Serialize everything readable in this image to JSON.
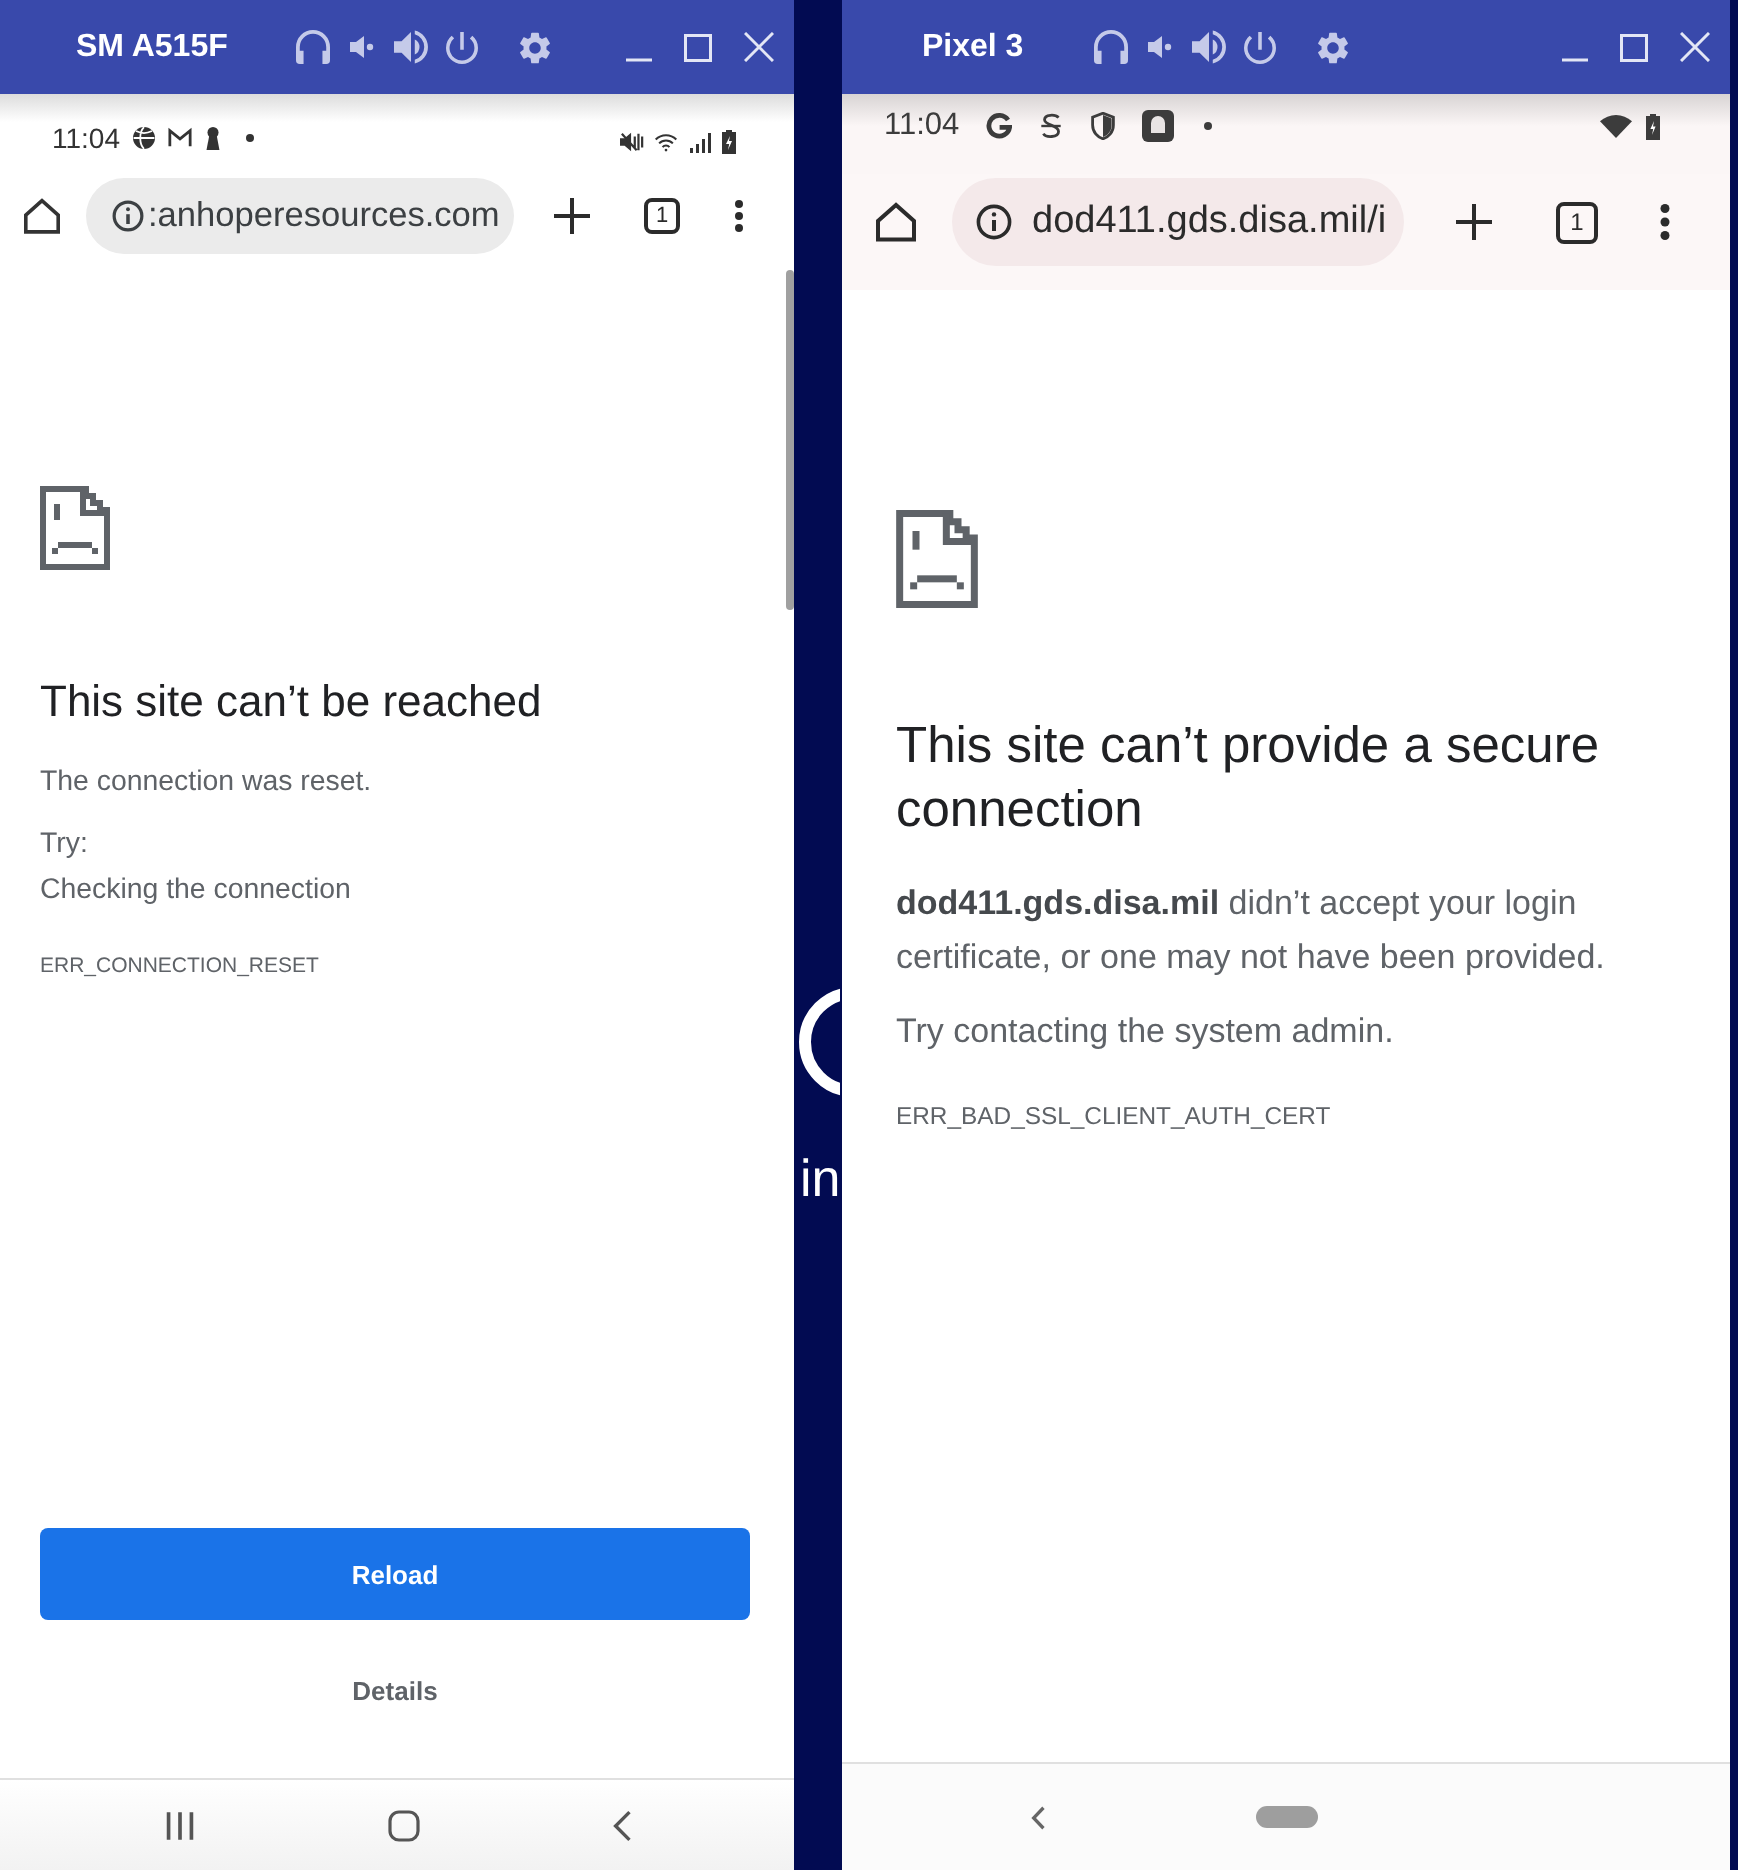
{
  "desktop": {
    "background_text": "in"
  },
  "windows": [
    {
      "kind": "samsung",
      "title": "SM A515F",
      "status_bar": {
        "time": "11:04"
      },
      "toolbar": {
        "url": ":anhoperesources.com",
        "tab_count": "1"
      },
      "error": {
        "heading": "This site can’t be reached",
        "paragraphs": [
          "The connection was reset."
        ],
        "suggestions_heading": "Try:",
        "suggestions": [
          "Checking the connection"
        ],
        "code": "ERR_CONNECTION_RESET"
      },
      "buttons": [
        {
          "label": "Reload",
          "kind": "primary"
        },
        {
          "label": "Details",
          "kind": "text"
        }
      ]
    },
    {
      "kind": "pixel",
      "title": "Pixel 3",
      "status_bar": {
        "time": "11:04"
      },
      "toolbar": {
        "url": "dod411.gds.disa.mil/i",
        "tab_count": "1"
      },
      "error": {
        "heading": "This site can’t provide a secure connection",
        "paragraphs": [
          "**dod411.gds.disa.mil** didn’t accept your login certificate, or one may not have been provided.",
          "Try contacting the system admin."
        ],
        "code": "ERR_BAD_SSL_CLIENT_AUTH_CERT"
      }
    }
  ]
}
